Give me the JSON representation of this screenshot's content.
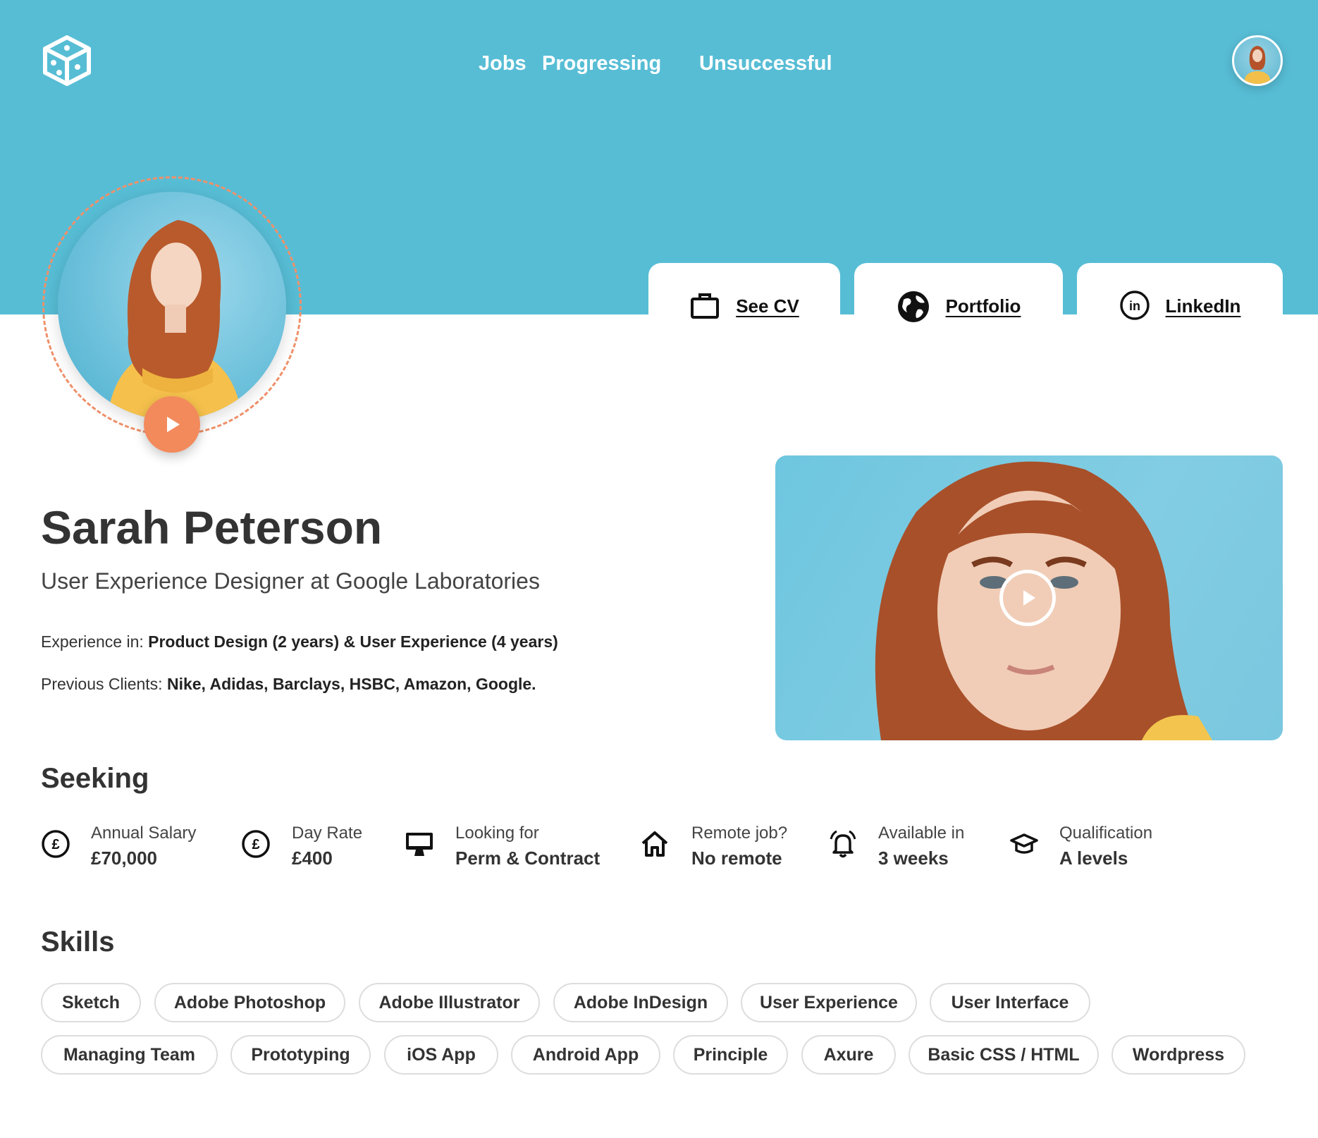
{
  "header": {
    "logo_icon": "dice-cube-logo-icon",
    "nav": [
      {
        "label": "Jobs"
      },
      {
        "label": "Progressing"
      },
      {
        "label": "Unsuccessful"
      }
    ],
    "avatar_icon": "user-avatar"
  },
  "links": [
    {
      "label": "See CV",
      "icon": "briefcase-icon"
    },
    {
      "label": "Portfolio",
      "icon": "globe-icon"
    },
    {
      "label": "LinkedIn",
      "icon": "linkedin-icon"
    }
  ],
  "profile": {
    "name": "Sarah Peterson",
    "title": "User Experience Designer at Google Laboratories",
    "experience_label": "Experience in:",
    "experience_value": "Product Design (2 years) & User Experience (4 years)",
    "clients_label": "Previous Clients:",
    "clients_value": "Nike, Adidas, Barclays, HSBC, Amazon, Google."
  },
  "colors": {
    "hero": "#57bdd5",
    "accent": "#f28a5c",
    "text": "#333333"
  },
  "seeking": {
    "title": "Seeking",
    "items": [
      {
        "label": "Annual Salary",
        "value": "£70,000",
        "icon": "pound-coin-icon"
      },
      {
        "label": "Day Rate",
        "value": "£400",
        "icon": "pound-coin-icon"
      },
      {
        "label": "Looking for",
        "value": "Perm & Contract",
        "icon": "desktop-monitor-icon"
      },
      {
        "label": "Remote job?",
        "value": "No remote",
        "icon": "home-icon"
      },
      {
        "label": "Available in",
        "value": "3 weeks",
        "icon": "alarm-bell-icon"
      },
      {
        "label": "Qualification",
        "value": "A levels",
        "icon": "graduation-cap-icon"
      }
    ]
  },
  "skills": {
    "title": "Skills",
    "items": [
      "Sketch",
      "Adobe Photoshop",
      "Adobe Illustrator",
      "Adobe InDesign",
      "User Experience",
      "User Interface",
      "Managing Team",
      "Prototyping",
      "iOS App",
      "Android App",
      "Principle",
      "Axure",
      "Basic CSS / HTML",
      "Wordpress"
    ]
  }
}
